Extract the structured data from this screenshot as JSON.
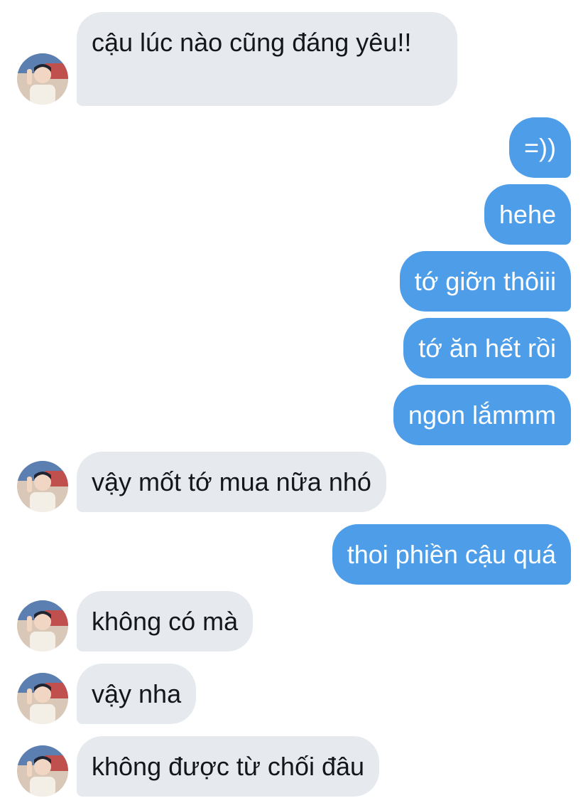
{
  "conversation": {
    "messages": [
      {
        "id": "m1",
        "direction": "incoming",
        "text": "cậu lúc nào cũng đáng yêu!!"
      },
      {
        "id": "m2",
        "direction": "outgoing",
        "text": "=))"
      },
      {
        "id": "m3",
        "direction": "outgoing",
        "text": "hehe"
      },
      {
        "id": "m4",
        "direction": "outgoing",
        "text": "tớ giỡn thôiii"
      },
      {
        "id": "m5",
        "direction": "outgoing",
        "text": "tớ ăn hết rồi"
      },
      {
        "id": "m6",
        "direction": "outgoing",
        "text": "ngon lắmmm"
      },
      {
        "id": "m7",
        "direction": "incoming",
        "text": "vậy mốt tớ mua nữa nhó"
      },
      {
        "id": "m8",
        "direction": "outgoing",
        "text": "thoi phiền cậu quá"
      },
      {
        "id": "m9",
        "direction": "incoming",
        "text": "không có mà"
      },
      {
        "id": "m10",
        "direction": "incoming",
        "text": "vậy nha"
      },
      {
        "id": "m11",
        "direction": "incoming",
        "text": "không được từ chối đâu"
      }
    ]
  },
  "colors": {
    "incoming_bubble": "#e6eaee",
    "outgoing_bubble": "#4d9de9",
    "incoming_text": "#14171a",
    "outgoing_text": "#ffffff"
  },
  "avatar_icon": "contact-avatar-icon"
}
